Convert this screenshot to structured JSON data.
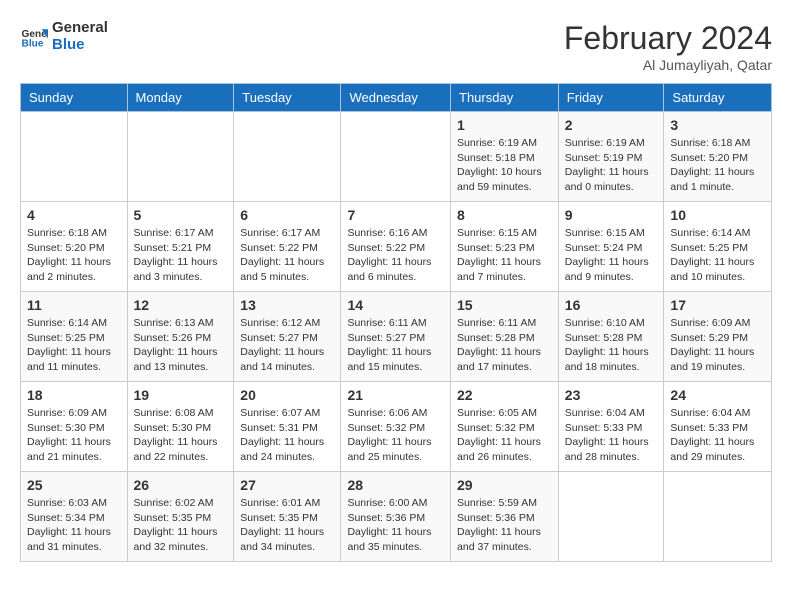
{
  "header": {
    "logo_line1": "General",
    "logo_line2": "Blue",
    "month_year": "February 2024",
    "location": "Al Jumayliyah, Qatar"
  },
  "weekdays": [
    "Sunday",
    "Monday",
    "Tuesday",
    "Wednesday",
    "Thursday",
    "Friday",
    "Saturday"
  ],
  "weeks": [
    [
      {
        "day": "",
        "info": ""
      },
      {
        "day": "",
        "info": ""
      },
      {
        "day": "",
        "info": ""
      },
      {
        "day": "",
        "info": ""
      },
      {
        "day": "1",
        "info": "Sunrise: 6:19 AM\nSunset: 5:18 PM\nDaylight: 10 hours and 59 minutes."
      },
      {
        "day": "2",
        "info": "Sunrise: 6:19 AM\nSunset: 5:19 PM\nDaylight: 11 hours and 0 minutes."
      },
      {
        "day": "3",
        "info": "Sunrise: 6:18 AM\nSunset: 5:20 PM\nDaylight: 11 hours and 1 minute."
      }
    ],
    [
      {
        "day": "4",
        "info": "Sunrise: 6:18 AM\nSunset: 5:20 PM\nDaylight: 11 hours and 2 minutes."
      },
      {
        "day": "5",
        "info": "Sunrise: 6:17 AM\nSunset: 5:21 PM\nDaylight: 11 hours and 3 minutes."
      },
      {
        "day": "6",
        "info": "Sunrise: 6:17 AM\nSunset: 5:22 PM\nDaylight: 11 hours and 5 minutes."
      },
      {
        "day": "7",
        "info": "Sunrise: 6:16 AM\nSunset: 5:22 PM\nDaylight: 11 hours and 6 minutes."
      },
      {
        "day": "8",
        "info": "Sunrise: 6:15 AM\nSunset: 5:23 PM\nDaylight: 11 hours and 7 minutes."
      },
      {
        "day": "9",
        "info": "Sunrise: 6:15 AM\nSunset: 5:24 PM\nDaylight: 11 hours and 9 minutes."
      },
      {
        "day": "10",
        "info": "Sunrise: 6:14 AM\nSunset: 5:25 PM\nDaylight: 11 hours and 10 minutes."
      }
    ],
    [
      {
        "day": "11",
        "info": "Sunrise: 6:14 AM\nSunset: 5:25 PM\nDaylight: 11 hours and 11 minutes."
      },
      {
        "day": "12",
        "info": "Sunrise: 6:13 AM\nSunset: 5:26 PM\nDaylight: 11 hours and 13 minutes."
      },
      {
        "day": "13",
        "info": "Sunrise: 6:12 AM\nSunset: 5:27 PM\nDaylight: 11 hours and 14 minutes."
      },
      {
        "day": "14",
        "info": "Sunrise: 6:11 AM\nSunset: 5:27 PM\nDaylight: 11 hours and 15 minutes."
      },
      {
        "day": "15",
        "info": "Sunrise: 6:11 AM\nSunset: 5:28 PM\nDaylight: 11 hours and 17 minutes."
      },
      {
        "day": "16",
        "info": "Sunrise: 6:10 AM\nSunset: 5:28 PM\nDaylight: 11 hours and 18 minutes."
      },
      {
        "day": "17",
        "info": "Sunrise: 6:09 AM\nSunset: 5:29 PM\nDaylight: 11 hours and 19 minutes."
      }
    ],
    [
      {
        "day": "18",
        "info": "Sunrise: 6:09 AM\nSunset: 5:30 PM\nDaylight: 11 hours and 21 minutes."
      },
      {
        "day": "19",
        "info": "Sunrise: 6:08 AM\nSunset: 5:30 PM\nDaylight: 11 hours and 22 minutes."
      },
      {
        "day": "20",
        "info": "Sunrise: 6:07 AM\nSunset: 5:31 PM\nDaylight: 11 hours and 24 minutes."
      },
      {
        "day": "21",
        "info": "Sunrise: 6:06 AM\nSunset: 5:32 PM\nDaylight: 11 hours and 25 minutes."
      },
      {
        "day": "22",
        "info": "Sunrise: 6:05 AM\nSunset: 5:32 PM\nDaylight: 11 hours and 26 minutes."
      },
      {
        "day": "23",
        "info": "Sunrise: 6:04 AM\nSunset: 5:33 PM\nDaylight: 11 hours and 28 minutes."
      },
      {
        "day": "24",
        "info": "Sunrise: 6:04 AM\nSunset: 5:33 PM\nDaylight: 11 hours and 29 minutes."
      }
    ],
    [
      {
        "day": "25",
        "info": "Sunrise: 6:03 AM\nSunset: 5:34 PM\nDaylight: 11 hours and 31 minutes."
      },
      {
        "day": "26",
        "info": "Sunrise: 6:02 AM\nSunset: 5:35 PM\nDaylight: 11 hours and 32 minutes."
      },
      {
        "day": "27",
        "info": "Sunrise: 6:01 AM\nSunset: 5:35 PM\nDaylight: 11 hours and 34 minutes."
      },
      {
        "day": "28",
        "info": "Sunrise: 6:00 AM\nSunset: 5:36 PM\nDaylight: 11 hours and 35 minutes."
      },
      {
        "day": "29",
        "info": "Sunrise: 5:59 AM\nSunset: 5:36 PM\nDaylight: 11 hours and 37 minutes."
      },
      {
        "day": "",
        "info": ""
      },
      {
        "day": "",
        "info": ""
      }
    ]
  ]
}
